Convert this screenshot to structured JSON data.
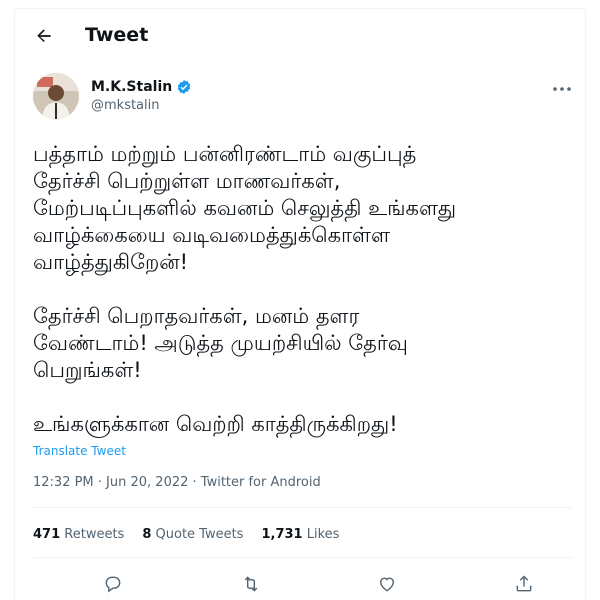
{
  "header": {
    "title": "Tweet",
    "back_icon": "arrow-left-icon"
  },
  "author": {
    "display_name": "M.K.Stalin",
    "handle": "@mkstalin",
    "verified_icon": "verified-badge-icon",
    "more_icon": "more-horizontal-icon"
  },
  "tweet": {
    "paragraphs": [
      [
        "பத்தாம் மற்றும் பன்னிரண்டாம் வகுப்புத்",
        "தேர்ச்சி பெற்றுள்ள மாணவர்கள்,",
        "மேற்படிப்புகளில் கவனம் செலுத்தி உங்களது",
        "வாழ்க்கையை வடிவமைத்துக்கொள்ள",
        "வாழ்த்துகிறேன்!"
      ],
      [
        "தேர்ச்சி பெறாதவர்கள், மனம் தளர",
        "வேண்டாம்! அடுத்த முயற்சியில் தேர்வு",
        "பெறுங்கள்!"
      ],
      [
        "உங்களுக்கான வெற்றி காத்திருக்கிறது!"
      ]
    ],
    "translate_label": "Translate Tweet",
    "timestamp": "12:32 PM · Jun 20, 2022 · Twitter for Android"
  },
  "stats": {
    "retweets_count": "471",
    "retweets_label": "Retweets",
    "quotes_count": "8",
    "quotes_label": "Quote Tweets",
    "likes_count": "1,731",
    "likes_label": "Likes"
  },
  "actions": [
    "reply-icon",
    "retweet-icon",
    "like-icon",
    "share-icon"
  ],
  "colors": {
    "accent": "#1d9bf0",
    "text": "#0f1419",
    "muted": "#536471",
    "border": "#eff3f4"
  }
}
